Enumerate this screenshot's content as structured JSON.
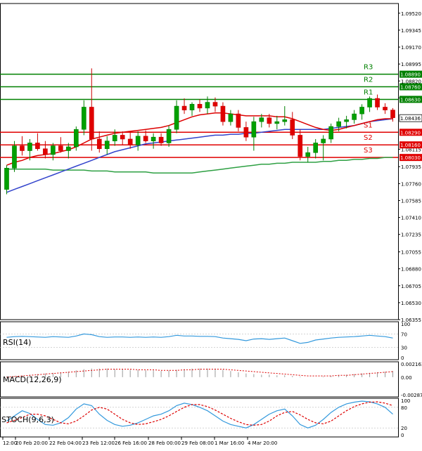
{
  "chart_data": {
    "type": "candlestick",
    "symbol": "EURUSD",
    "x_ticks": [
      "12:00",
      "20 Feb 20:00",
      "22 Feb 04:00",
      "23 Feb 12:00",
      "26 Feb 16:00",
      "28 Feb 00:00",
      "29 Feb 08:00",
      "1 Mar 16:00",
      "4 Mar 20:00"
    ],
    "price_ticks": [
      "1.09520",
      "1.09345",
      "1.09170",
      "1.08995",
      "1.08820",
      "1.08645",
      "1.08115",
      "1.07935",
      "1.07760",
      "1.07585",
      "1.07410",
      "1.07235",
      "1.07055",
      "1.06880",
      "1.06705",
      "1.06530",
      "1.06355"
    ],
    "ylim": [
      1.06355,
      1.0962
    ],
    "current_price": "1.08436",
    "current_price_value": 1.08436,
    "levels": [
      {
        "name": "R3",
        "label": "1.08890",
        "value": 1.0889,
        "color": "#008000"
      },
      {
        "name": "R2",
        "label": "1.08760",
        "value": 1.0876,
        "color": "#008000"
      },
      {
        "name": "R1",
        "label": "1.08630",
        "value": 1.0863,
        "color": "#008000"
      },
      {
        "name": "S1",
        "label": "1.08290",
        "value": 1.0829,
        "color": "#e00000"
      },
      {
        "name": "S2",
        "label": "1.08160",
        "value": 1.0816,
        "color": "#e00000"
      },
      {
        "name": "S3",
        "label": "1.08030",
        "value": 1.0803,
        "color": "#e00000"
      }
    ],
    "candles": [
      [
        1.077,
        1.0795,
        1.0765,
        1.0792
      ],
      [
        1.0792,
        1.082,
        1.0788,
        1.0815
      ],
      [
        1.0815,
        1.0825,
        1.0805,
        1.081
      ],
      [
        1.081,
        1.0822,
        1.08,
        1.0818
      ],
      [
        1.0818,
        1.0828,
        1.081,
        1.0812
      ],
      [
        1.0812,
        1.082,
        1.0802,
        1.0806
      ],
      [
        1.0806,
        1.0818,
        1.08,
        1.0815
      ],
      [
        1.0815,
        1.0824,
        1.0808,
        1.081
      ],
      [
        1.081,
        1.0818,
        1.0802,
        1.0814
      ],
      [
        1.0814,
        1.0835,
        1.081,
        1.0832
      ],
      [
        1.0832,
        1.0862,
        1.0826,
        1.0855
      ],
      [
        1.0855,
        1.0895,
        1.081,
        1.0822
      ],
      [
        1.0822,
        1.083,
        1.0808,
        1.0812
      ],
      [
        1.0812,
        1.0825,
        1.0806,
        1.082
      ],
      [
        1.082,
        1.0832,
        1.0815,
        1.0826
      ],
      [
        1.0826,
        1.083,
        1.0816,
        1.0822
      ],
      [
        1.0822,
        1.0829,
        1.0812,
        1.0816
      ],
      [
        1.0816,
        1.083,
        1.081,
        1.0825
      ],
      [
        1.0825,
        1.0831,
        1.0818,
        1.082
      ],
      [
        1.082,
        1.0828,
        1.0812,
        1.0824
      ],
      [
        1.0824,
        1.0828,
        1.0815,
        1.0818
      ],
      [
        1.0818,
        1.0836,
        1.0814,
        1.0832
      ],
      [
        1.0832,
        1.0862,
        1.0828,
        1.0856
      ],
      [
        1.0856,
        1.0864,
        1.0848,
        1.0852
      ],
      [
        1.0852,
        1.086,
        1.0846,
        1.0858
      ],
      [
        1.0858,
        1.0863,
        1.085,
        1.0854
      ],
      [
        1.0854,
        1.0866,
        1.0848,
        1.086
      ],
      [
        1.086,
        1.0865,
        1.085,
        1.0856
      ],
      [
        1.0856,
        1.086,
        1.0836,
        1.084
      ],
      [
        1.084,
        1.0852,
        1.0836,
        1.0848
      ],
      [
        1.0848,
        1.0852,
        1.083,
        1.0834
      ],
      [
        1.0834,
        1.084,
        1.082,
        1.0824
      ],
      [
        1.0824,
        1.0845,
        1.081,
        1.084
      ],
      [
        1.084,
        1.0848,
        1.0834,
        1.0844
      ],
      [
        1.0844,
        1.0848,
        1.0834,
        1.0838
      ],
      [
        1.0838,
        1.0846,
        1.0832,
        1.084
      ],
      [
        1.084,
        1.0856,
        1.0836,
        1.0842
      ],
      [
        1.0842,
        1.085,
        1.0822,
        1.0826
      ],
      [
        1.0826,
        1.0832,
        1.08,
        1.0804
      ],
      [
        1.0804,
        1.0814,
        1.0798,
        1.0808
      ],
      [
        1.0808,
        1.0822,
        1.0802,
        1.0818
      ],
      [
        1.0818,
        1.0826,
        1.08,
        1.0822
      ],
      [
        1.0822,
        1.0838,
        1.0818,
        1.0835
      ],
      [
        1.0835,
        1.0844,
        1.083,
        1.084
      ],
      [
        1.084,
        1.0846,
        1.0833,
        1.0842
      ],
      [
        1.0842,
        1.0852,
        1.0838,
        1.0848
      ],
      [
        1.0848,
        1.0858,
        1.0842,
        1.0855
      ],
      [
        1.0855,
        1.0866,
        1.085,
        1.0864
      ],
      [
        1.0864,
        1.0868,
        1.0852,
        1.0855
      ],
      [
        1.0855,
        1.0859,
        1.0848,
        1.0852
      ],
      [
        1.0852,
        1.0854,
        1.084,
        1.0844
      ]
    ],
    "ma_red": [
      1.0795,
      1.0798,
      1.08,
      1.0803,
      1.0805,
      1.0806,
      1.0807,
      1.0809,
      1.0811,
      1.0814,
      1.0818,
      1.0822,
      1.0824,
      1.0826,
      1.0828,
      1.0829,
      1.083,
      1.0831,
      1.0832,
      1.0833,
      1.0834,
      1.0836,
      1.0839,
      1.0842,
      1.0845,
      1.0847,
      1.0848,
      1.0849,
      1.0849,
      1.0848,
      1.0847,
      1.0846,
      1.0846,
      1.0846,
      1.0846,
      1.0845,
      1.0845,
      1.0843,
      1.084,
      1.0837,
      1.0834,
      1.0832,
      1.0831,
      1.0832,
      1.0834,
      1.0836,
      1.0838,
      1.084,
      1.0842,
      1.0843,
      1.0843
    ],
    "ma_blue": [
      1.0767,
      1.077,
      1.0773,
      1.0776,
      1.0779,
      1.0782,
      1.0785,
      1.0788,
      1.0791,
      1.0794,
      1.0797,
      1.08,
      1.0803,
      1.0806,
      1.0809,
      1.0811,
      1.0813,
      1.0815,
      1.0817,
      1.0818,
      1.0819,
      1.082,
      1.0821,
      1.0822,
      1.0823,
      1.0824,
      1.0825,
      1.0826,
      1.0826,
      1.0827,
      1.0827,
      1.0828,
      1.0828,
      1.0829,
      1.083,
      1.0831,
      1.0832,
      1.0832,
      1.0832,
      1.0832,
      1.0832,
      1.0832,
      1.0833,
      1.0834,
      1.0835,
      1.0836,
      1.0838,
      1.084,
      1.0841,
      1.0842,
      1.0843
    ],
    "ma_green": [
      1.0791,
      1.0791,
      1.0791,
      1.0791,
      1.0791,
      1.0791,
      1.079,
      1.079,
      1.079,
      1.079,
      1.079,
      1.0789,
      1.0789,
      1.0789,
      1.0788,
      1.0788,
      1.0788,
      1.0788,
      1.0788,
      1.0787,
      1.0787,
      1.0787,
      1.0787,
      1.0787,
      1.0787,
      1.0788,
      1.0789,
      1.079,
      1.0791,
      1.0792,
      1.0793,
      1.0794,
      1.0795,
      1.0796,
      1.0796,
      1.0797,
      1.0797,
      1.0798,
      1.0798,
      1.0798,
      1.0798,
      1.0799,
      1.0799,
      1.08,
      1.08,
      1.0801,
      1.0801,
      1.0802,
      1.0802,
      1.0803,
      1.0803
    ],
    "indicators": {
      "rsi": {
        "label": "RSI(14)",
        "ticks": [
          "100",
          "70",
          "30",
          "0"
        ],
        "ylim": [
          0,
          100
        ],
        "values": [
          60,
          62,
          63,
          62,
          61,
          60,
          62,
          61,
          60,
          64,
          70,
          68,
          62,
          60,
          61,
          61,
          60,
          61,
          60,
          61,
          60,
          62,
          66,
          64,
          64,
          63,
          63,
          62,
          58,
          56,
          54,
          50,
          55,
          56,
          54,
          56,
          58,
          50,
          42,
          45,
          52,
          55,
          58,
          60,
          61,
          62,
          64,
          66,
          64,
          62,
          58
        ]
      },
      "macd": {
        "label": "MACD(12,26,9)",
        "ticks": [
          "0.002163",
          "0.00",
          "-0.002879"
        ],
        "ylim": [
          -0.002879,
          0.002163
        ],
        "hist": [
          0.0001,
          0.0002,
          0.0003,
          0.0004,
          0.0005,
          0.0006,
          0.0007,
          0.0008,
          0.0009,
          0.0011,
          0.0013,
          0.0014,
          0.0014,
          0.0014,
          0.0013,
          0.0013,
          0.0012,
          0.0012,
          0.0011,
          0.0011,
          0.001,
          0.0011,
          0.0012,
          0.0013,
          0.0014,
          0.0014,
          0.0014,
          0.0014,
          0.0012,
          0.001,
          0.0008,
          0.0006,
          0.0005,
          0.0004,
          0.0004,
          0.0003,
          0.0003,
          0.0002,
          0.0001,
          0.0,
          0.0,
          0.0001,
          0.0002,
          0.0003,
          0.0004,
          0.0005,
          0.0006,
          0.0007,
          0.0008,
          0.0009,
          0.001
        ],
        "signal": [
          0.0,
          0.0001,
          0.0002,
          0.0003,
          0.0004,
          0.0005,
          0.0006,
          0.0007,
          0.0008,
          0.0009,
          0.001,
          0.0011,
          0.0012,
          0.0013,
          0.0013,
          0.0013,
          0.0013,
          0.0012,
          0.0012,
          0.0012,
          0.0011,
          0.0011,
          0.0011,
          0.0012,
          0.0012,
          0.0013,
          0.0013,
          0.0013,
          0.0013,
          0.0012,
          0.0011,
          0.001,
          0.0009,
          0.0008,
          0.0007,
          0.0006,
          0.0005,
          0.0004,
          0.0003,
          0.0002,
          0.0002,
          0.0002,
          0.0002,
          0.0003,
          0.0003,
          0.0004,
          0.0005,
          0.0006,
          0.0007,
          0.0008,
          0.0009
        ]
      },
      "stoch": {
        "label": "STOCH(9,6,3)",
        "ticks": [
          "100",
          "80",
          "20",
          "0"
        ],
        "ylim": [
          0,
          100
        ],
        "k": [
          40,
          55,
          70,
          62,
          45,
          30,
          28,
          35,
          50,
          75,
          90,
          85,
          60,
          42,
          30,
          25,
          28,
          35,
          45,
          55,
          60,
          70,
          85,
          92,
          88,
          80,
          70,
          55,
          40,
          30,
          25,
          20,
          30,
          45,
          60,
          70,
          75,
          55,
          30,
          20,
          28,
          45,
          65,
          80,
          90,
          95,
          98,
          96,
          90,
          80,
          60
        ],
        "d": [
          35,
          42,
          50,
          60,
          60,
          55,
          45,
          35,
          32,
          40,
          55,
          72,
          80,
          75,
          60,
          45,
          35,
          30,
          32,
          38,
          45,
          55,
          68,
          80,
          88,
          88,
          82,
          72,
          60,
          48,
          38,
          30,
          28,
          30,
          40,
          55,
          65,
          68,
          58,
          45,
          35,
          32,
          40,
          55,
          70,
          82,
          90,
          95,
          96,
          92,
          85
        ]
      }
    }
  }
}
